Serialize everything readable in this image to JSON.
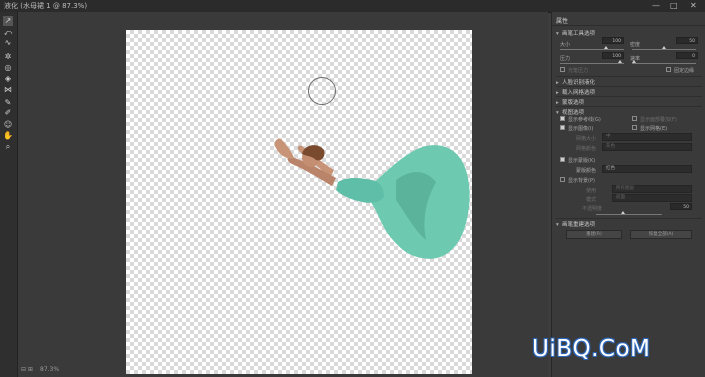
{
  "window": {
    "title": "液化 (水母裙 1 @ 87.3%)",
    "controls": [
      "—",
      "□",
      "✕"
    ]
  },
  "tools": [
    {
      "icon": "forward-warp-icon",
      "glyph": "↗",
      "active": true
    },
    {
      "icon": "reconstruct-icon",
      "glyph": "⤺"
    },
    {
      "icon": "smooth-icon",
      "glyph": "∿"
    },
    {
      "icon": "twirl-icon",
      "glyph": "✲"
    },
    {
      "icon": "pucker-icon",
      "glyph": "◎"
    },
    {
      "icon": "bloat-icon",
      "glyph": "◈"
    },
    {
      "icon": "push-left-icon",
      "glyph": "⋈"
    },
    {
      "icon": "freeze-mask-icon",
      "glyph": "✎"
    },
    {
      "icon": "thaw-mask-icon",
      "glyph": "✐"
    },
    {
      "icon": "face-tool-icon",
      "glyph": "☺"
    },
    {
      "icon": "hand-icon",
      "glyph": "✋"
    },
    {
      "icon": "zoom-icon",
      "glyph": "⌕"
    }
  ],
  "status": {
    "left": "⊟ ⊞",
    "zoom": "87.3%"
  },
  "panel": {
    "header": "属性",
    "brush_tool_options": {
      "label": "画笔工具选项",
      "size_label": "大小",
      "size_value": "100",
      "density_label": "密度",
      "density_value": "50",
      "pressure_label": "压力",
      "pressure_value": "100",
      "rate_label": "速率",
      "rate_value": "0",
      "stylus_label": "光笔压力",
      "pin_edges_label": "固定边缘"
    },
    "face_aware": "人脸识别液化",
    "load_mesh": "载入网格选项",
    "mask_options": "蒙版选项",
    "view_options": {
      "label": "视图选项",
      "show_guides": "显示参考线(G)",
      "show_face_overlay": "显示面部叠加(F)",
      "show_image": "显示图像(I)",
      "show_mesh": "显示网格(E)",
      "mesh_size_label": "网格大小",
      "mesh_size_value": "中",
      "mesh_color_label": "网格颜色",
      "mesh_color_value": "灰色",
      "show_mask": "显示蒙版(K)",
      "mask_color_label": "蒙版颜色",
      "mask_color_value": "红色",
      "show_backdrop": "显示背景(P)",
      "use_label": "使用",
      "use_value": "所有图层",
      "mode_label": "模式",
      "mode_value": "前面",
      "opacity_label": "不透明度",
      "opacity_value": "50"
    },
    "brush_reconstruct": {
      "label": "画笔重建选项",
      "reconstruct_btn": "重建(R)",
      "restore_btn": "恢复全部(A)"
    }
  },
  "watermark": "UiBQ.CoM"
}
